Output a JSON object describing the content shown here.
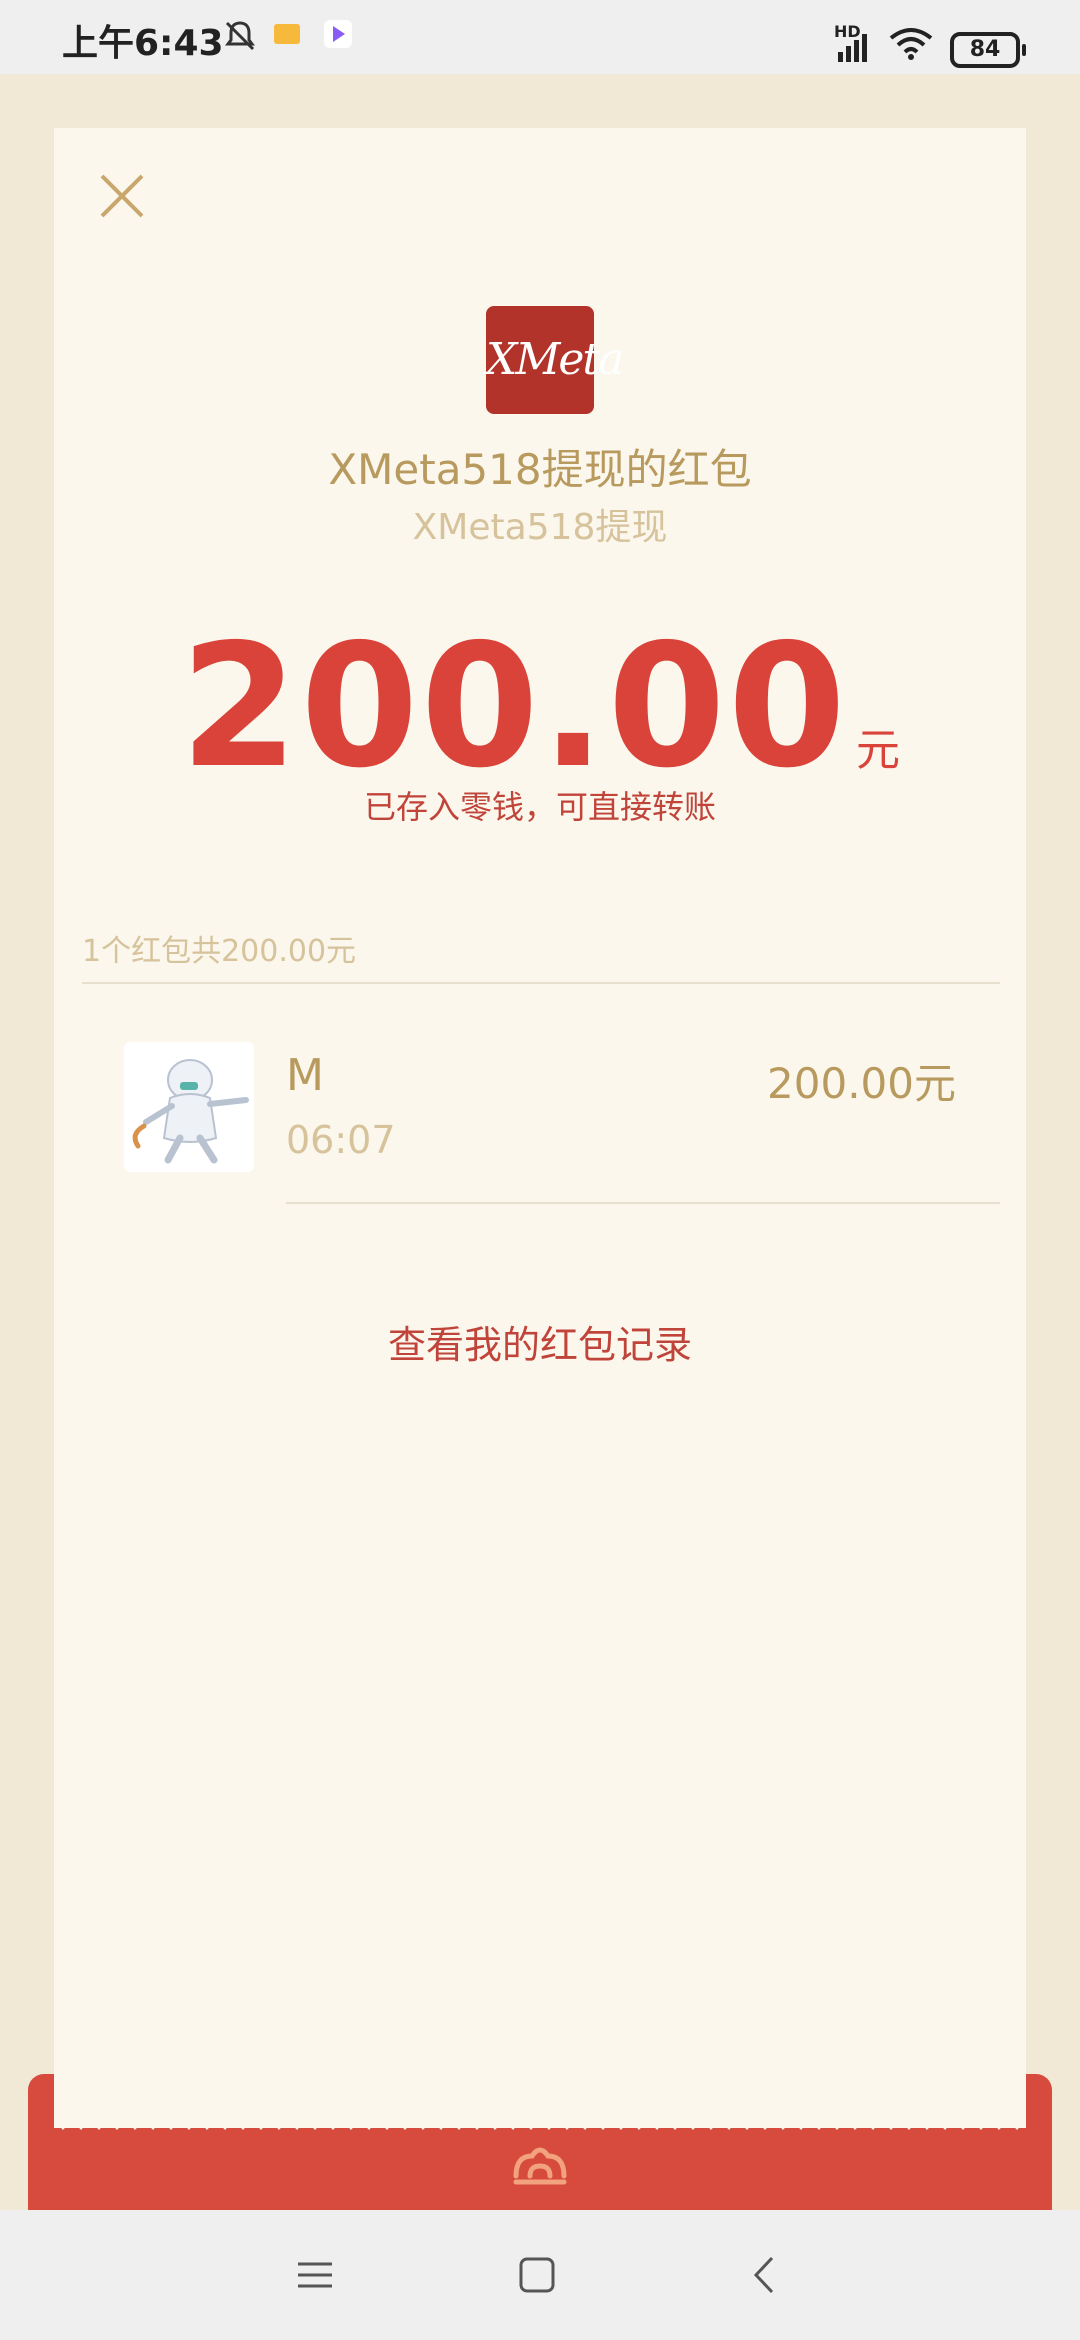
{
  "status_bar": {
    "time": "上午6:43",
    "battery": "84",
    "signal_label": "HD"
  },
  "card": {
    "logo_text": "XMeta",
    "title": "XMeta518提现的红包",
    "subtitle": "XMeta518提现",
    "amount": "200.00",
    "unit": "元",
    "note": "已存入零钱，可直接转账",
    "summary": "1个红包共200.00元",
    "record": {
      "name": "M",
      "time": "06:07",
      "amount": "200.00元"
    },
    "view_records_label": "查看我的红包记录"
  },
  "colors": {
    "accent_red": "#D9433A",
    "gold": "#B89A5E",
    "card_bg": "#FBF7EC"
  }
}
